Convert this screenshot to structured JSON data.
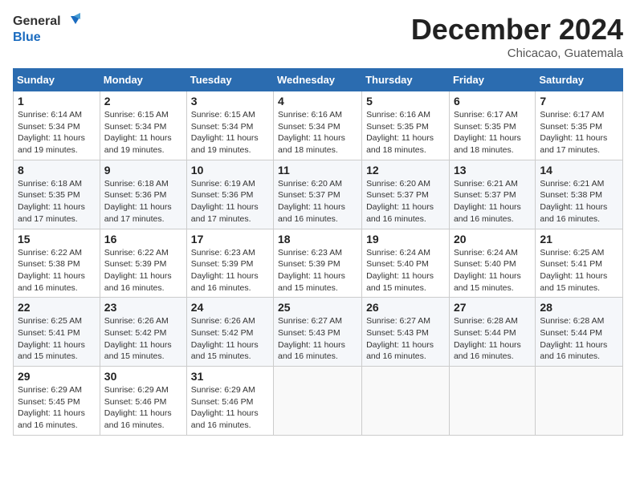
{
  "header": {
    "logo_general": "General",
    "logo_blue": "Blue",
    "month_title": "December 2024",
    "location": "Chicacao, Guatemala"
  },
  "days_of_week": [
    "Sunday",
    "Monday",
    "Tuesday",
    "Wednesday",
    "Thursday",
    "Friday",
    "Saturday"
  ],
  "weeks": [
    [
      {
        "day": "1",
        "info": "Sunrise: 6:14 AM\nSunset: 5:34 PM\nDaylight: 11 hours and 19 minutes."
      },
      {
        "day": "2",
        "info": "Sunrise: 6:15 AM\nSunset: 5:34 PM\nDaylight: 11 hours and 19 minutes."
      },
      {
        "day": "3",
        "info": "Sunrise: 6:15 AM\nSunset: 5:34 PM\nDaylight: 11 hours and 19 minutes."
      },
      {
        "day": "4",
        "info": "Sunrise: 6:16 AM\nSunset: 5:34 PM\nDaylight: 11 hours and 18 minutes."
      },
      {
        "day": "5",
        "info": "Sunrise: 6:16 AM\nSunset: 5:35 PM\nDaylight: 11 hours and 18 minutes."
      },
      {
        "day": "6",
        "info": "Sunrise: 6:17 AM\nSunset: 5:35 PM\nDaylight: 11 hours and 18 minutes."
      },
      {
        "day": "7",
        "info": "Sunrise: 6:17 AM\nSunset: 5:35 PM\nDaylight: 11 hours and 17 minutes."
      }
    ],
    [
      {
        "day": "8",
        "info": "Sunrise: 6:18 AM\nSunset: 5:35 PM\nDaylight: 11 hours and 17 minutes."
      },
      {
        "day": "9",
        "info": "Sunrise: 6:18 AM\nSunset: 5:36 PM\nDaylight: 11 hours and 17 minutes."
      },
      {
        "day": "10",
        "info": "Sunrise: 6:19 AM\nSunset: 5:36 PM\nDaylight: 11 hours and 17 minutes."
      },
      {
        "day": "11",
        "info": "Sunrise: 6:20 AM\nSunset: 5:37 PM\nDaylight: 11 hours and 16 minutes."
      },
      {
        "day": "12",
        "info": "Sunrise: 6:20 AM\nSunset: 5:37 PM\nDaylight: 11 hours and 16 minutes."
      },
      {
        "day": "13",
        "info": "Sunrise: 6:21 AM\nSunset: 5:37 PM\nDaylight: 11 hours and 16 minutes."
      },
      {
        "day": "14",
        "info": "Sunrise: 6:21 AM\nSunset: 5:38 PM\nDaylight: 11 hours and 16 minutes."
      }
    ],
    [
      {
        "day": "15",
        "info": "Sunrise: 6:22 AM\nSunset: 5:38 PM\nDaylight: 11 hours and 16 minutes."
      },
      {
        "day": "16",
        "info": "Sunrise: 6:22 AM\nSunset: 5:39 PM\nDaylight: 11 hours and 16 minutes."
      },
      {
        "day": "17",
        "info": "Sunrise: 6:23 AM\nSunset: 5:39 PM\nDaylight: 11 hours and 16 minutes."
      },
      {
        "day": "18",
        "info": "Sunrise: 6:23 AM\nSunset: 5:39 PM\nDaylight: 11 hours and 15 minutes."
      },
      {
        "day": "19",
        "info": "Sunrise: 6:24 AM\nSunset: 5:40 PM\nDaylight: 11 hours and 15 minutes."
      },
      {
        "day": "20",
        "info": "Sunrise: 6:24 AM\nSunset: 5:40 PM\nDaylight: 11 hours and 15 minutes."
      },
      {
        "day": "21",
        "info": "Sunrise: 6:25 AM\nSunset: 5:41 PM\nDaylight: 11 hours and 15 minutes."
      }
    ],
    [
      {
        "day": "22",
        "info": "Sunrise: 6:25 AM\nSunset: 5:41 PM\nDaylight: 11 hours and 15 minutes."
      },
      {
        "day": "23",
        "info": "Sunrise: 6:26 AM\nSunset: 5:42 PM\nDaylight: 11 hours and 15 minutes."
      },
      {
        "day": "24",
        "info": "Sunrise: 6:26 AM\nSunset: 5:42 PM\nDaylight: 11 hours and 15 minutes."
      },
      {
        "day": "25",
        "info": "Sunrise: 6:27 AM\nSunset: 5:43 PM\nDaylight: 11 hours and 16 minutes."
      },
      {
        "day": "26",
        "info": "Sunrise: 6:27 AM\nSunset: 5:43 PM\nDaylight: 11 hours and 16 minutes."
      },
      {
        "day": "27",
        "info": "Sunrise: 6:28 AM\nSunset: 5:44 PM\nDaylight: 11 hours and 16 minutes."
      },
      {
        "day": "28",
        "info": "Sunrise: 6:28 AM\nSunset: 5:44 PM\nDaylight: 11 hours and 16 minutes."
      }
    ],
    [
      {
        "day": "29",
        "info": "Sunrise: 6:29 AM\nSunset: 5:45 PM\nDaylight: 11 hours and 16 minutes."
      },
      {
        "day": "30",
        "info": "Sunrise: 6:29 AM\nSunset: 5:46 PM\nDaylight: 11 hours and 16 minutes."
      },
      {
        "day": "31",
        "info": "Sunrise: 6:29 AM\nSunset: 5:46 PM\nDaylight: 11 hours and 16 minutes."
      },
      null,
      null,
      null,
      null
    ]
  ]
}
